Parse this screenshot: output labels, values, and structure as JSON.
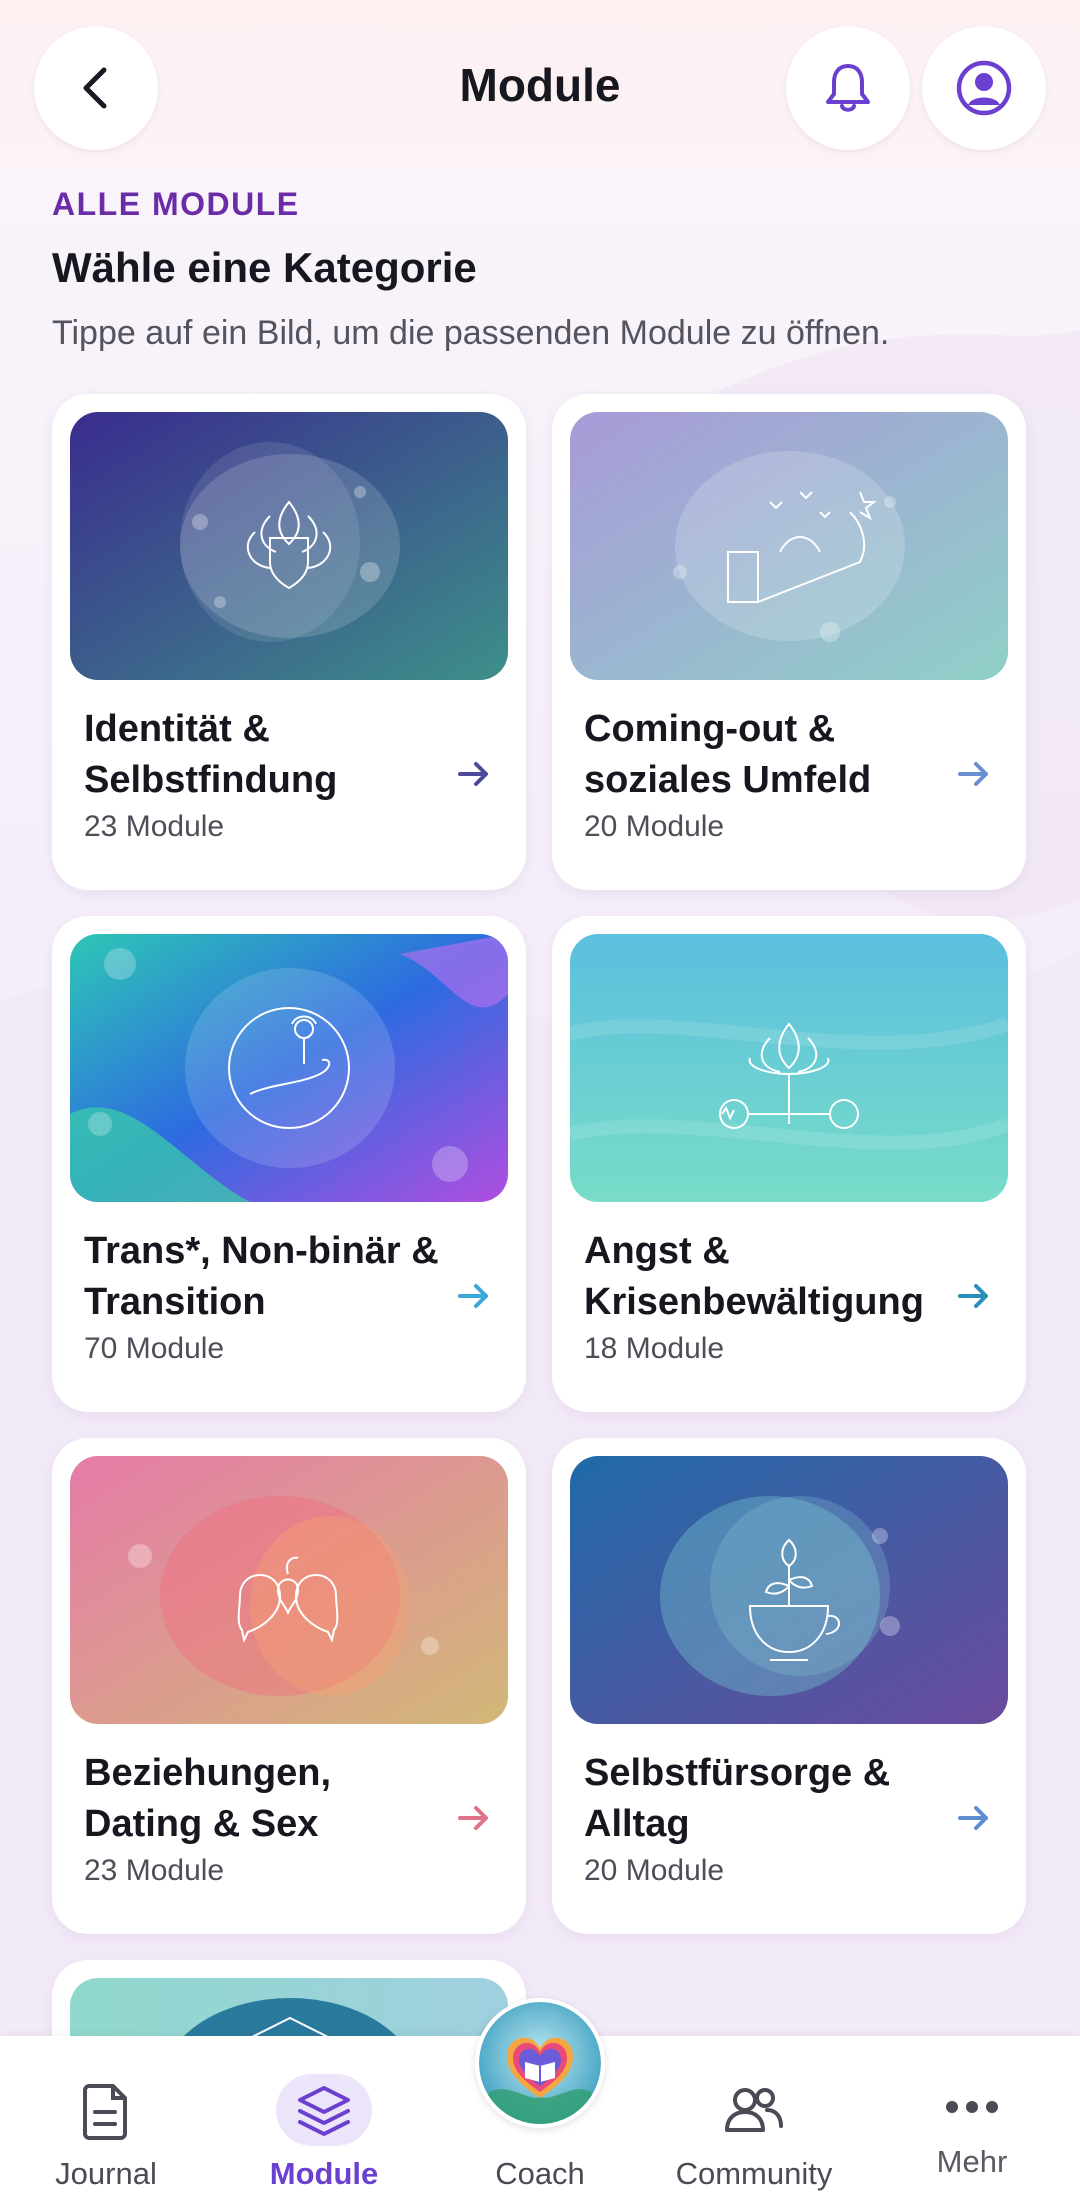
{
  "header": {
    "title": "Module"
  },
  "section": {
    "eyebrow": "ALLE MODULE",
    "title": "Wähle eine Kategorie",
    "subtitle": "Tippe auf ein Bild, um die passenden Module zu öffnen."
  },
  "categories": [
    {
      "title": "Identität & Selbstfindung",
      "count": "23 Module",
      "icon": "lotus-shield-icon",
      "arrow_color": "#4b4a9b"
    },
    {
      "title": "Coming-out & soziales Umfeld",
      "count": "20 Module",
      "icon": "door-butterflies-icon",
      "arrow_color": "#6a8fd0"
    },
    {
      "title": "Trans*, Non-binär & Transition",
      "count": "70 Module",
      "icon": "hand-flower-icon",
      "arrow_color": "#3aa7d6"
    },
    {
      "title": "Angst & Krisenbewältigung",
      "count": "18 Module",
      "icon": "lotus-pulse-icon",
      "arrow_color": "#2a8fb8"
    },
    {
      "title": "Beziehungen, Dating & Sex",
      "count": "23 Module",
      "icon": "hearts-bubbles-icon",
      "arrow_color": "#e0738a"
    },
    {
      "title": "Selbstfürsorge & Alltag",
      "count": "20 Module",
      "icon": "teacup-flower-icon",
      "arrow_color": "#5c8ed0"
    }
  ],
  "nav": {
    "journal": "Journal",
    "module": "Module",
    "coach": "Coach",
    "community": "Community",
    "mehr": "Mehr"
  },
  "colors": {
    "accent": "#6b2ca8",
    "nav_active": "#6b3fd0"
  }
}
